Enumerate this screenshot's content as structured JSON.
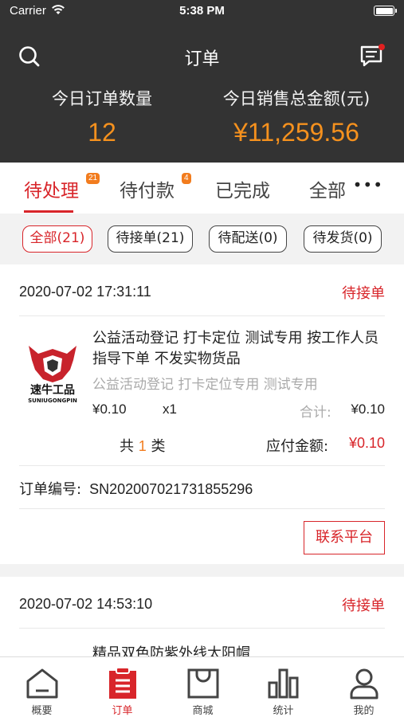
{
  "status_bar": {
    "carrier": "Carrier",
    "time": "5:38 PM"
  },
  "nav": {
    "title": "订单"
  },
  "stats": {
    "order_count_label": "今日订单数量",
    "order_count": "12",
    "sales_total_label": "今日销售总金额(元)",
    "sales_total": "¥11,259.56"
  },
  "tabs": [
    {
      "label": "待处理",
      "badge": "21"
    },
    {
      "label": "待付款",
      "badge": "4"
    },
    {
      "label": "已完成"
    },
    {
      "label": "全部"
    }
  ],
  "filters": [
    "全部(21)",
    "待接单(21)",
    "待配送(0)",
    "待发货(0)"
  ],
  "orders": [
    {
      "datetime": "2020-07-02 17:31:11",
      "status": "待接单",
      "logo_text": "速牛工品",
      "logo_sub": "SUNIUGONGPIN",
      "product_title": "公益活动登记 打卡定位 测试专用 按工作人员指导下单 不发实物货品",
      "product_sub": "公益活动登记 打卡定位专用 测试专用",
      "price": "¥0.10",
      "qty": "x1",
      "subtotal_label": "合计:",
      "subtotal": "¥0.10",
      "count_prefix": "共",
      "count": "1",
      "count_suffix": "类",
      "pay_label": "应付金额:",
      "pay_amount": "¥0.10",
      "order_no_label": "订单编号:",
      "order_no": "SN202007021731855296",
      "contact_label": "联系平台"
    },
    {
      "datetime": "2020-07-02 14:53:10",
      "status": "待接单",
      "product_title": "精品双色防紫外线太阳帽"
    }
  ],
  "tabbar": [
    {
      "label": "概要",
      "icon": "home-icon"
    },
    {
      "label": "订单",
      "icon": "order-icon"
    },
    {
      "label": "商城",
      "icon": "shop-bag-icon"
    },
    {
      "label": "统计",
      "icon": "bar-chart-icon"
    },
    {
      "label": "我的",
      "icon": "user-icon"
    }
  ],
  "colors": {
    "accent": "#d8252a",
    "orange": "#f5911e",
    "header_bg": "#333333"
  }
}
